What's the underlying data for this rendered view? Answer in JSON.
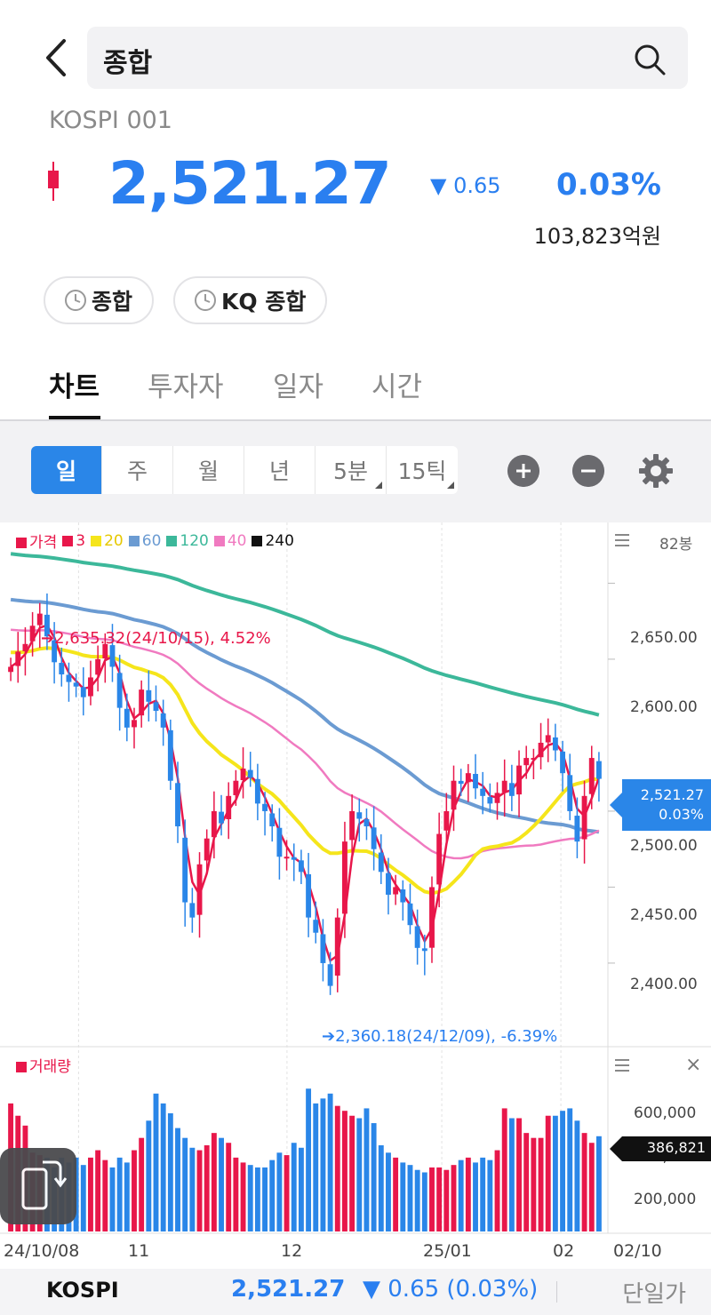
{
  "header": {
    "search_text": "종합",
    "index_code": "KOSPI 001",
    "price": "2,521.27",
    "change": "▼ 0.65",
    "change_pct": "0.03%",
    "trade_amount": "103,823억원",
    "chips": [
      "종합",
      "KQ 종합"
    ]
  },
  "tabs": [
    "차트",
    "투자자",
    "일자",
    "시간"
  ],
  "toolbar": {
    "periods": [
      "일",
      "주",
      "월",
      "년",
      "5분",
      "15틱"
    ],
    "active_period": "일"
  },
  "chart": {
    "legend": [
      {
        "label": "가격",
        "color": "#e8174a"
      },
      {
        "label": "3",
        "color": "#e8174a"
      },
      {
        "label": "20",
        "color": "#f5e51b"
      },
      {
        "label": "60",
        "color": "#6b9bd2"
      },
      {
        "label": "120",
        "color": "#3cb89a"
      },
      {
        "label": "40",
        "color": "#f07ac0"
      },
      {
        "label": "240",
        "color": "#111111"
      }
    ],
    "bar_count": "82봉",
    "high_annotation": "2,635.32(24/10/15), 4.52%",
    "low_annotation": "2,360.18(24/12/09), -6.39%",
    "price_tag": "2,521.27",
    "price_tag_pct": "0.03%",
    "volume_label": "거래량",
    "volume_tag": "386,821",
    "close_symbol": "×"
  },
  "chart_data": {
    "type": "candlestick+volume",
    "price_axis": {
      "ticks": [
        "2,650.00",
        "2,600.00",
        "2,500.00",
        "2,450.00",
        "2,400.00"
      ],
      "range": [
        2345,
        2690
      ]
    },
    "volume_axis": {
      "ticks": [
        "600,000",
        "400,000",
        "200,000"
      ],
      "range": [
        0,
        700000
      ]
    },
    "x_ticks": [
      "24/10/08",
      "11",
      "12",
      "25/01",
      "02",
      "02/10"
    ],
    "close": [
      2595,
      2605,
      2610,
      2622,
      2630,
      2615,
      2598,
      2590,
      2585,
      2582,
      2575,
      2588,
      2600,
      2610,
      2595,
      2568,
      2555,
      2560,
      2580,
      2572,
      2566,
      2555,
      2520,
      2490,
      2440,
      2430,
      2465,
      2482,
      2500,
      2492,
      2510,
      2520,
      2528,
      2522,
      2505,
      2500,
      2490,
      2470,
      2470,
      2468,
      2460,
      2430,
      2420,
      2400,
      2385,
      2430,
      2480,
      2500,
      2495,
      2490,
      2475,
      2460,
      2445,
      2450,
      2440,
      2425,
      2410,
      2408,
      2450,
      2485,
      2500,
      2520,
      2518,
      2525,
      2515,
      2510,
      2505,
      2512,
      2520,
      2510,
      2530,
      2535,
      2535,
      2545,
      2550,
      2540,
      2525,
      2500,
      2480,
      2510,
      2535,
      2521.27
    ],
    "volume": [
      520000,
      470000,
      430000,
      320000,
      310000,
      300000,
      260000,
      300000,
      280000,
      300000,
      270000,
      300000,
      330000,
      290000,
      260000,
      300000,
      280000,
      330000,
      380000,
      450000,
      560000,
      520000,
      480000,
      420000,
      380000,
      340000,
      330000,
      350000,
      400000,
      380000,
      360000,
      300000,
      280000,
      270000,
      260000,
      260000,
      290000,
      320000,
      310000,
      360000,
      340000,
      580000,
      520000,
      540000,
      560000,
      510000,
      490000,
      470000,
      460000,
      500000,
      440000,
      350000,
      320000,
      300000,
      280000,
      270000,
      250000,
      240000,
      260000,
      260000,
      250000,
      270000,
      290000,
      300000,
      280000,
      300000,
      290000,
      330000,
      500000,
      460000,
      460000,
      400000,
      380000,
      380000,
      470000,
      470000,
      490000,
      500000,
      450000,
      400000,
      360000,
      386821
    ]
  },
  "bottom_bar": {
    "name": "KOSPI",
    "price": "2,521.27",
    "change": "▼ 0.65 (0.03%)",
    "mode": "단일가"
  }
}
